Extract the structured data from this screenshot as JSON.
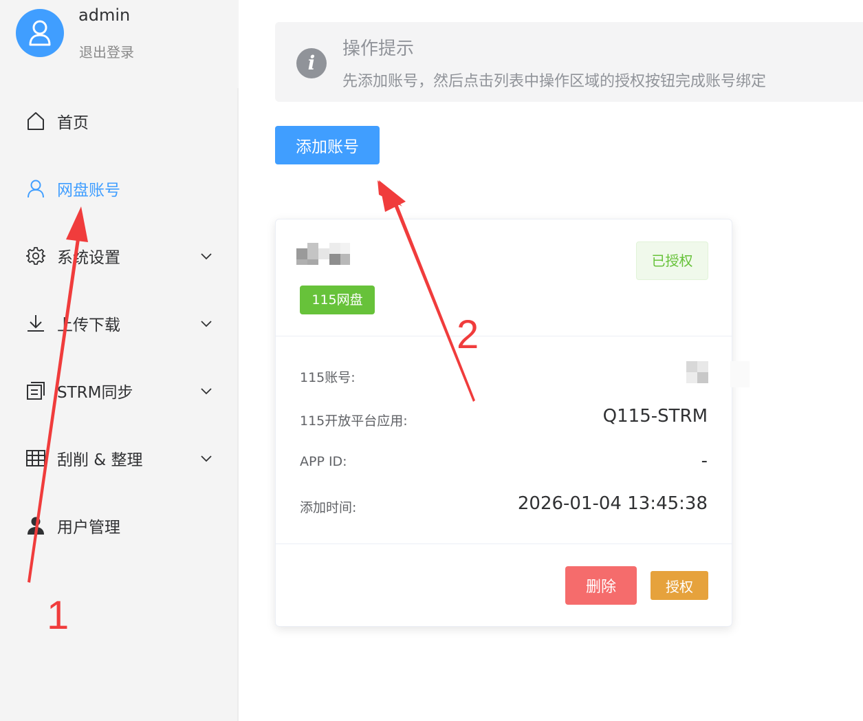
{
  "user": {
    "name": "admin",
    "logout_label": "退出登录"
  },
  "sidebar": {
    "items": [
      {
        "label": "首页",
        "icon": "home-icon",
        "active": false,
        "expandable": false
      },
      {
        "label": "网盘账号",
        "icon": "user-icon",
        "active": true,
        "expandable": false
      },
      {
        "label": "系统设置",
        "icon": "gear-icon",
        "active": false,
        "expandable": true
      },
      {
        "label": "上传下载",
        "icon": "download-icon",
        "active": false,
        "expandable": true
      },
      {
        "label": "STRM同步",
        "icon": "document-icon",
        "active": false,
        "expandable": true
      },
      {
        "label": "刮削 & 整理",
        "icon": "grid-icon",
        "active": false,
        "expandable": true
      },
      {
        "label": "用户管理",
        "icon": "person-icon",
        "active": false,
        "expandable": false
      }
    ]
  },
  "tip": {
    "title": "操作提示",
    "description": "先添加账号，然后点击列表中操作区域的授权按钮完成账号绑定"
  },
  "toolbar": {
    "add_label": "添加账号"
  },
  "account_card": {
    "tag": "115网盘",
    "status": "已授权",
    "rows": [
      {
        "label": "115账号:",
        "value": ""
      },
      {
        "label": "115开放平台应用:",
        "value": "Q115-STRM"
      },
      {
        "label": "APP ID:",
        "value": "-"
      },
      {
        "label": "添加时间:",
        "value": "2026-01-04 13:45:38"
      }
    ],
    "delete_label": "删除",
    "authorize_label": "授权"
  },
  "annotations": {
    "one": "1",
    "two": "2"
  },
  "colors": {
    "primary": "#409eff",
    "success": "#67c23a",
    "danger": "#f56c6c",
    "warning": "#e6a23c",
    "annotation": "#f03c3c"
  }
}
